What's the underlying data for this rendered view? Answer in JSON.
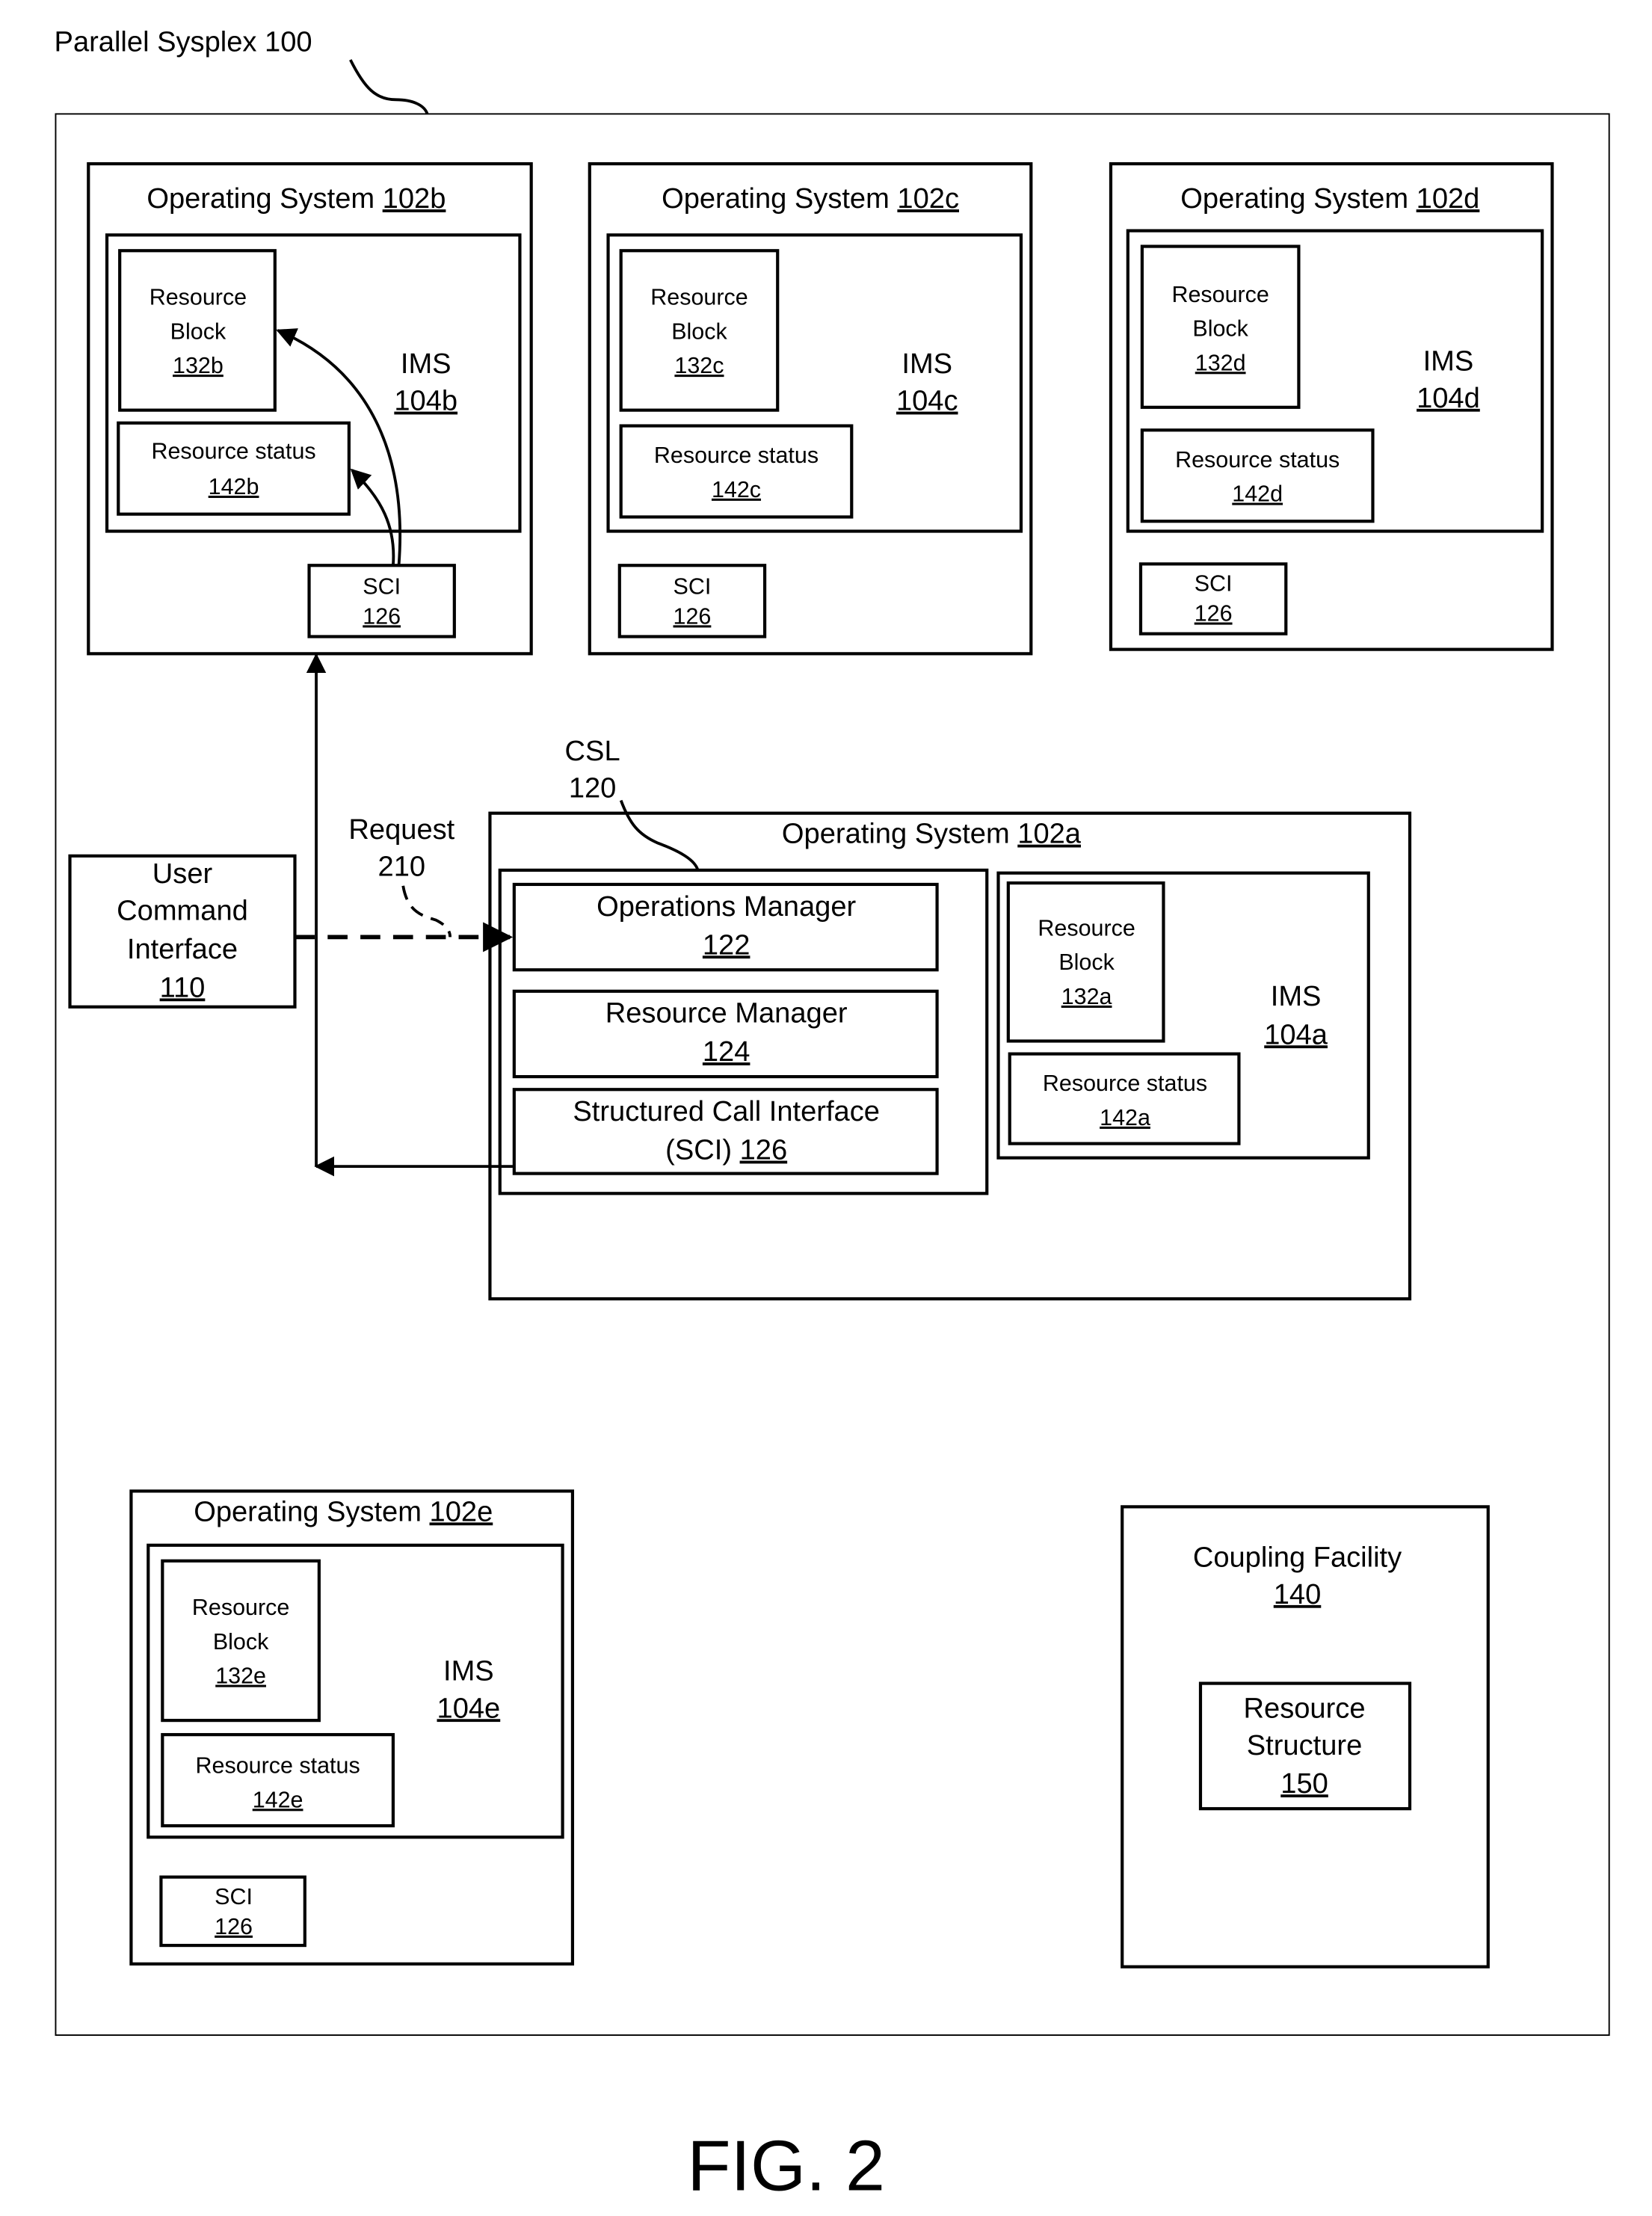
{
  "figure": {
    "caption": "FIG. 2",
    "sysplex_label": "Parallel Sysplex 100"
  },
  "os_b": {
    "title": "Operating System ",
    "title_ref": "102b",
    "ims": "IMS",
    "ims_ref": "104b",
    "block_lines": [
      "Resource",
      "Block"
    ],
    "block_ref": "132b",
    "status": "Resource status",
    "status_ref": "142b",
    "sci": "SCI",
    "sci_ref": "126"
  },
  "os_c": {
    "title": "Operating System ",
    "title_ref": "102c",
    "ims": "IMS",
    "ims_ref": "104c",
    "block_lines": [
      "Resource",
      "Block"
    ],
    "block_ref": "132c",
    "status": "Resource status",
    "status_ref": "142c",
    "sci": "SCI",
    "sci_ref": "126"
  },
  "os_d": {
    "title": "Operating System ",
    "title_ref": "102d",
    "ims": "IMS",
    "ims_ref": "104d",
    "block_lines": [
      "Resource",
      "Block"
    ],
    "block_ref": "132d",
    "status": "Resource status",
    "status_ref": "142d",
    "sci": "SCI",
    "sci_ref": "126"
  },
  "os_e": {
    "title": "Operating System ",
    "title_ref": "102e",
    "ims": "IMS",
    "ims_ref": "104e",
    "block_lines": [
      "Resource",
      "Block"
    ],
    "block_ref": "132e",
    "status": "Resource status",
    "status_ref": "142e",
    "sci": "SCI",
    "sci_ref": "126"
  },
  "os_a": {
    "title": "Operating System ",
    "title_ref": "102a",
    "csl": "CSL",
    "csl_ref": "120",
    "ops_manager": "Operations Manager",
    "ops_manager_ref": "122",
    "resource_manager": "Resource Manager",
    "resource_manager_ref": "124",
    "sci_line1": "Structured Call Interface",
    "sci_line2": "(SCI) ",
    "sci_ref": "126",
    "ims": "IMS",
    "ims_ref": "104a",
    "block_lines": [
      "Resource",
      "Block"
    ],
    "block_ref": "132a",
    "status": "Resource status",
    "status_ref": "142a"
  },
  "user_cmd": {
    "lines": [
      "User",
      "Command",
      "Interface"
    ],
    "ref": "110"
  },
  "request": {
    "label": "Request",
    "ref": "210"
  },
  "coupling": {
    "title": "Coupling Facility",
    "ref": "140",
    "structure_lines": [
      "Resource",
      "Structure"
    ],
    "structure_ref": "150"
  }
}
